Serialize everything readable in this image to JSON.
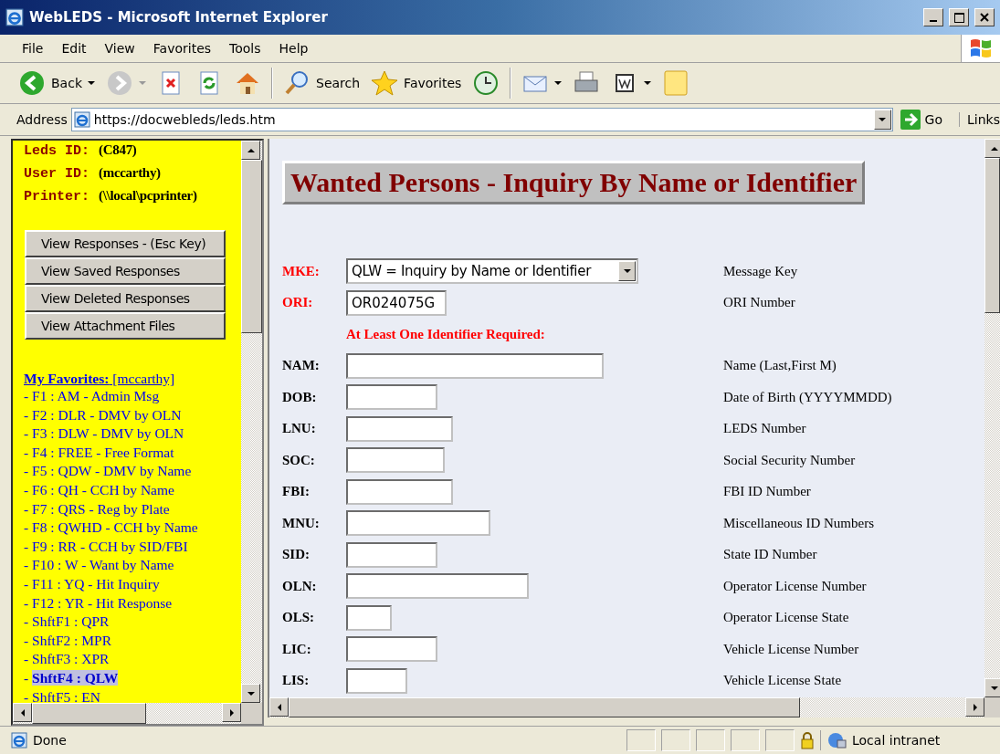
{
  "window": {
    "title": "WebLEDS - Microsoft Internet Explorer"
  },
  "menu": [
    {
      "label": "File"
    },
    {
      "label": "Edit"
    },
    {
      "label": "View"
    },
    {
      "label": "Favorites"
    },
    {
      "label": "Tools"
    },
    {
      "label": "Help"
    }
  ],
  "toolbar": [
    {
      "kind": "back",
      "label": "Back",
      "dropdown": true
    },
    {
      "kind": "forward",
      "dropdown": true
    },
    {
      "kind": "stop"
    },
    {
      "kind": "refresh"
    },
    {
      "kind": "home"
    },
    {
      "kind": "separator"
    },
    {
      "kind": "search",
      "label": "Search"
    },
    {
      "kind": "favorites",
      "label": "Favorites"
    },
    {
      "kind": "history"
    },
    {
      "kind": "separator"
    },
    {
      "kind": "mail",
      "dropdown": true
    },
    {
      "kind": "print"
    },
    {
      "kind": "edit",
      "dropdown": true
    },
    {
      "kind": "note"
    }
  ],
  "address": {
    "label": "Address",
    "url": "https://docwebleds/leds.htm",
    "go": "Go",
    "links": "Links"
  },
  "sidebar": {
    "info": [
      {
        "label": "Leds ID:",
        "value": "(C847)"
      },
      {
        "label": "User ID:",
        "value": "(mccarthy)"
      },
      {
        "label": "Printer:",
        "value": "(\\\\local\\pcprinter)"
      }
    ],
    "buttons": [
      {
        "label": "View Responses - (Esc Key)"
      },
      {
        "label": "View Saved Responses"
      },
      {
        "label": "View Deleted Responses"
      },
      {
        "label": "View Attachment Files"
      }
    ],
    "favorites_heading": "**My Favorites:** [mccarthy]",
    "favorites": [
      {
        "text": "- F1 : AM - Admin Msg",
        "selected": false
      },
      {
        "text": "- F2 : DLR - DMV by OLN",
        "selected": false
      },
      {
        "text": "- F3 : DLW - DMV by OLN",
        "selected": false
      },
      {
        "text": "- F4 : FREE - Free Format",
        "selected": false
      },
      {
        "text": "- F5 : QDW - DMV by Name",
        "selected": false
      },
      {
        "text": "- F6 : QH - CCH by Name",
        "selected": false
      },
      {
        "text": "- F7 : QRS - Reg by Plate",
        "selected": false
      },
      {
        "text": "- F8 : QWHD - CCH by Name",
        "selected": false
      },
      {
        "text": "- F9 : RR - CCH by SID/FBI",
        "selected": false
      },
      {
        "text": "- F10 : W - Want by Name",
        "selected": false
      },
      {
        "text": "- F11 : YQ - Hit Inquiry",
        "selected": false
      },
      {
        "text": "- F12 : YR - Hit Response",
        "selected": false
      },
      {
        "text": "- ShftF1 : QPR",
        "selected": false
      },
      {
        "text": "- ShftF2 : MPR",
        "selected": false
      },
      {
        "text": "- ShftF3 : XPR",
        "selected": false
      },
      {
        "prefix": "- ",
        "text": "ShftF4 : QLW",
        "selected": true
      },
      {
        "text": "- ShftF5 : EN",
        "selected": false
      }
    ]
  },
  "form": {
    "title": "Wanted Persons - Inquiry By Name or Identifier",
    "fields": [
      {
        "kind": "select",
        "label": "MKE:",
        "required": true,
        "value": "QLW = Inquiry by Name or Identifier",
        "description": "Message Key"
      },
      {
        "kind": "text",
        "label": "ORI:",
        "required": true,
        "value": "OR024075G",
        "description": "ORI Number"
      },
      {
        "kind": "note",
        "text": "At Least One Identifier Required:"
      },
      {
        "kind": "text",
        "label": "NAM:",
        "required": false,
        "description": "Name (Last,First M)"
      },
      {
        "kind": "text",
        "label": "DOB:",
        "required": false,
        "description": "Date of Birth (YYYYMMDD)"
      },
      {
        "kind": "text",
        "label": "LNU:",
        "required": false,
        "description": "LEDS Number"
      },
      {
        "kind": "text",
        "label": "SOC:",
        "required": false,
        "description": "Social Security Number"
      },
      {
        "kind": "text",
        "label": "FBI:",
        "required": false,
        "description": "FBI ID Number"
      },
      {
        "kind": "text",
        "label": "MNU:",
        "required": false,
        "description": "Miscellaneous ID Numbers"
      },
      {
        "kind": "text",
        "label": "SID:",
        "required": false,
        "description": "State ID Number"
      },
      {
        "kind": "text",
        "label": "OLN:",
        "required": false,
        "description": "Operator License Number"
      },
      {
        "kind": "text",
        "label": "OLS:",
        "required": false,
        "description": "Operator License State"
      },
      {
        "kind": "text",
        "label": "LIC:",
        "required": false,
        "description": "Vehicle License Number"
      },
      {
        "kind": "text",
        "label": "LIS:",
        "required": false,
        "description": "Vehicle License State"
      }
    ]
  },
  "status_bar": {
    "text": "Done",
    "zone": "Local intranet"
  }
}
